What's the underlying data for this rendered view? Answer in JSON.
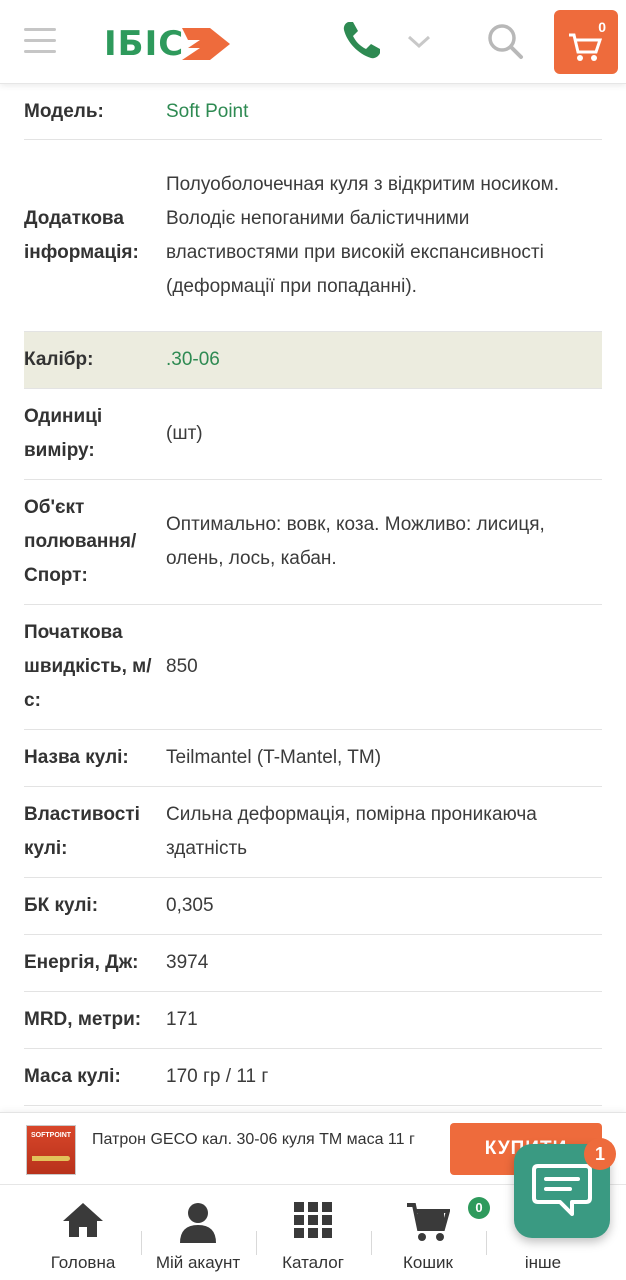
{
  "header": {
    "logo_text": "ІБІС",
    "cart_count": "0",
    "brand_color": "#2e9a5c",
    "accent_color": "#ee6b3c"
  },
  "specs": [
    {
      "label": "Модель:",
      "value": "Soft Point",
      "link": true
    },
    {
      "label": "Додаткова інформація:",
      "value": "Полуоболочечная куля з відкритим носиком. Володіє непоганими балістичними властивостями при високій експансивності (деформації при попаданні)."
    },
    {
      "label": "Калібр:",
      "value": ".30-06",
      "link": true,
      "highlight": true
    },
    {
      "label": "Одиниці виміру:",
      "value": "(шт)"
    },
    {
      "label": "Об'єкт полювання/ Спорт:",
      "value": "Оптимально: вовк, коза. Можливо: лисиця, олень, лось, кабан."
    },
    {
      "label": "Початкова швидкість, м/с:",
      "value": "850"
    },
    {
      "label": "Назва кулі:",
      "value": "Teilmantel (T-Mantel, TM)"
    },
    {
      "label": "Властивості кулі:",
      "value": "Сильна деформація, помірна проникаюча здатність"
    },
    {
      "label": "БК кулі:",
      "value": "0,305"
    },
    {
      "label": "Енергія, Дж:",
      "value": "3974"
    },
    {
      "label": "MRD, метри:",
      "value": "171"
    },
    {
      "label": "Маса кулі:",
      "value": "170 гр / 11 г"
    }
  ],
  "buybar": {
    "thumb_text": "SOFTPOINT",
    "title": "Патрон GECO кал. 30-06 куля ТМ маса 11 г",
    "buy_label": "КУПИТИ"
  },
  "chat": {
    "badge": "1"
  },
  "nav": {
    "items": [
      {
        "label": "Головна",
        "icon": "home-icon"
      },
      {
        "label": "Мій акаунт",
        "icon": "user-icon"
      },
      {
        "label": "Каталог",
        "icon": "grid-icon"
      },
      {
        "label": "Кошик",
        "icon": "cart-icon"
      },
      {
        "label": "інше",
        "icon": "more-icon"
      }
    ],
    "cart_badge": "0"
  }
}
